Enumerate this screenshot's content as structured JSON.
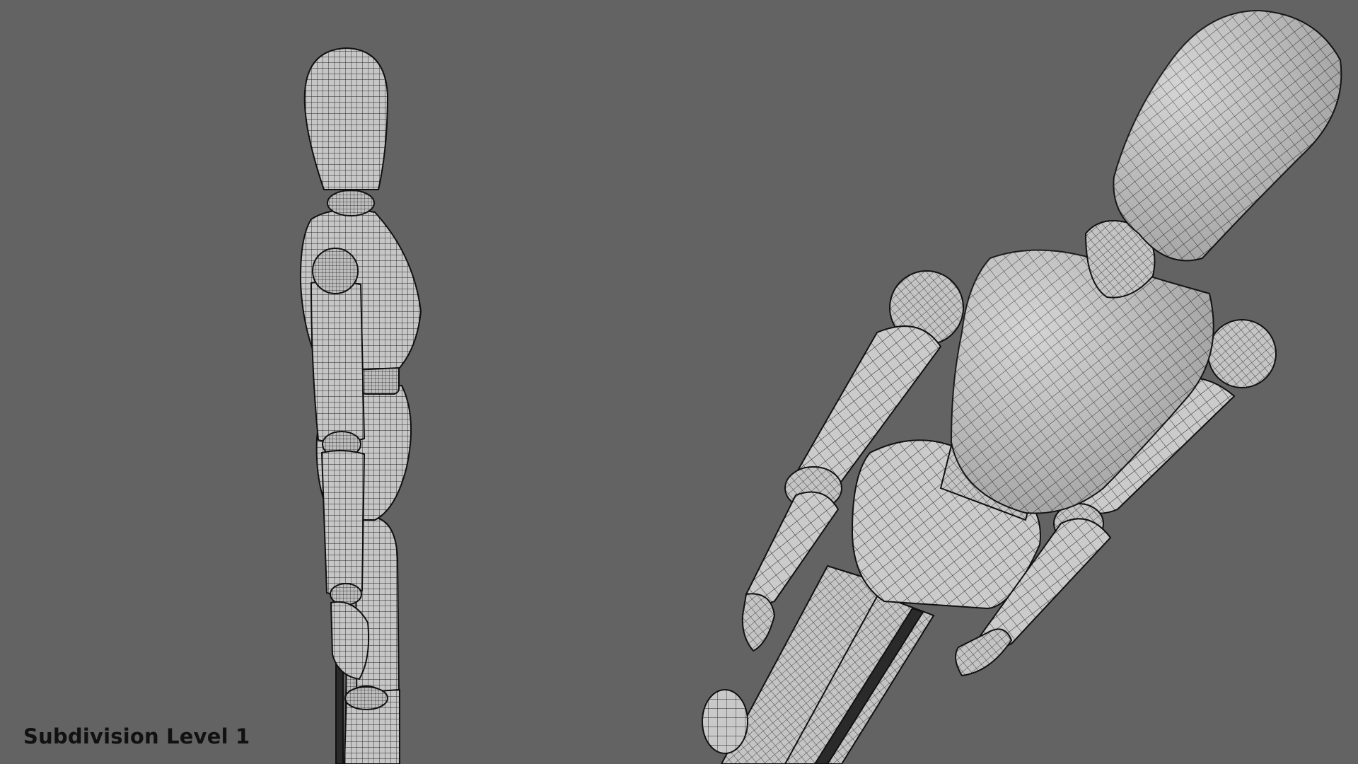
{
  "overlay": {
    "caption": "Subdivision Level 1"
  },
  "colors": {
    "background": "#636363",
    "mesh_fill": "#c9c9c9",
    "mesh_shade": "#a9a9a9",
    "wire": "#1a1a1a",
    "caption_text": "#111111"
  },
  "scene": {
    "left_figure": "wooden-mannequin-side-view",
    "right_figure": "wooden-mannequin-low-angle-view",
    "render_style": "wireframe-on-shaded"
  }
}
